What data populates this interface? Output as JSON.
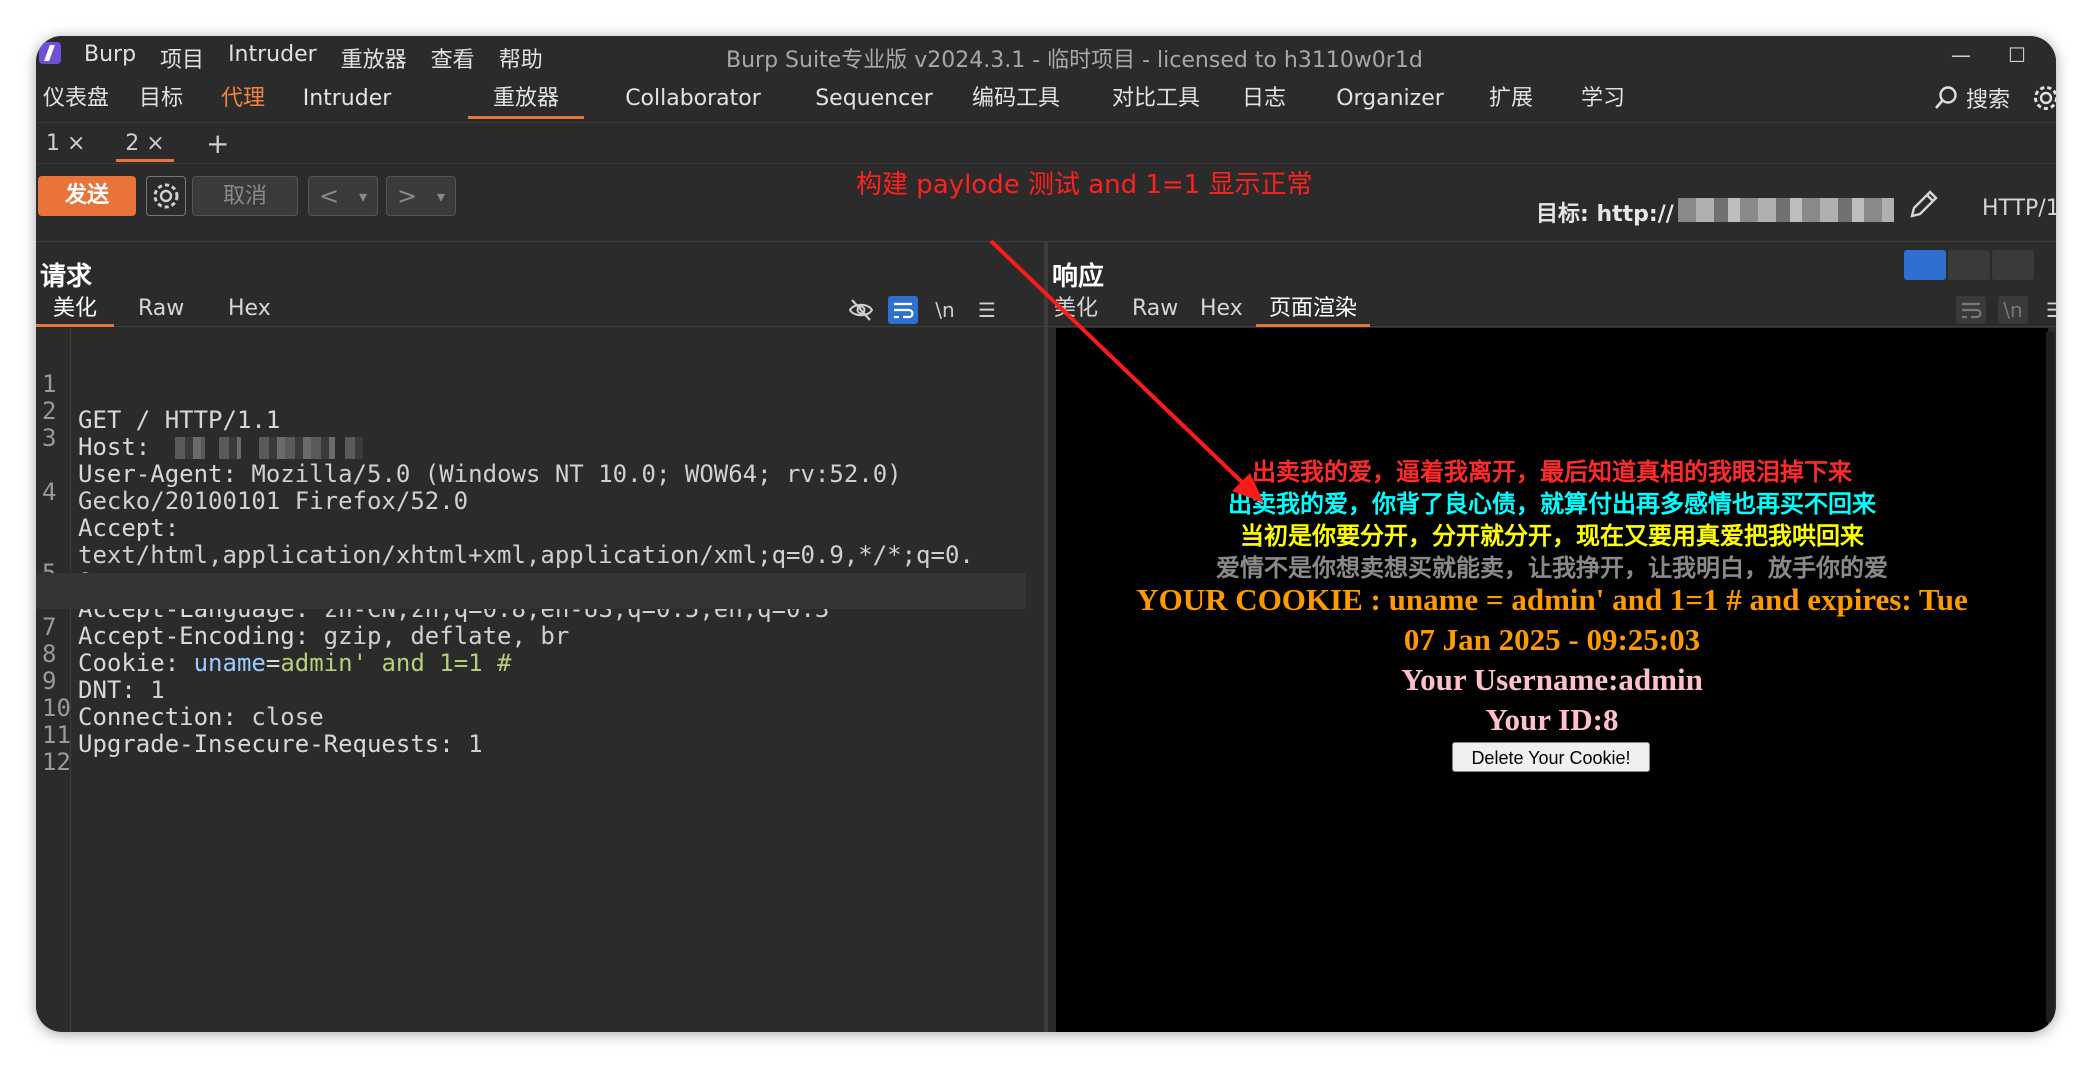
{
  "titlebar": {
    "menu": [
      "Burp",
      "项目",
      "Intruder",
      "重放器",
      "查看",
      "帮助"
    ],
    "title": "Burp Suite专业版  v2024.3.1 - 临时项目 - licensed to h3110w0r1d"
  },
  "main_tabs": [
    "仪表盘",
    "目标",
    "代理",
    "Intruder",
    "重放器",
    "Collaborator",
    "Sequencer",
    "编码工具",
    "对比工具",
    "日志",
    "Organizer",
    "扩展",
    "学习"
  ],
  "main_tab_active": "重放器",
  "search_label": "搜索",
  "repeater_tabs": [
    {
      "label": "1 ×"
    },
    {
      "label": "2 ×",
      "active": true
    }
  ],
  "add_tab_label": "+",
  "toolbar": {
    "send_label": "发送",
    "cancel_label": "取消",
    "prev_label": "<",
    "next_label": ">",
    "dropdown_label": "▾",
    "target_label": "目标: http://",
    "protocol_label": "HTTP/1"
  },
  "annotation": "构建 paylode 测试 and 1=1 显示正常",
  "request": {
    "title": "请求",
    "tabs": [
      "美化",
      "Raw",
      "Hex"
    ],
    "newline_label": "\\n",
    "lines": [
      {
        "n": "1",
        "key": "GET / HTTP/1.1",
        "sep": "",
        "value": ""
      },
      {
        "n": "2",
        "key": "Host",
        "sep": ": ",
        "value": ""
      },
      {
        "n": "3",
        "key": "User-Agent",
        "sep": ": ",
        "value": "Mozilla/5.0 (Windows NT 10.0; WOW64; rv:52.0)"
      },
      {
        "n": "",
        "key": "",
        "sep": "",
        "value": "Gecko/20100101 Firefox/52.0"
      },
      {
        "n": "4",
        "key": "Accept",
        "sep": ":",
        "value": ""
      },
      {
        "n": "",
        "key": "",
        "sep": "",
        "value": "text/html,application/xhtml+xml,application/xml;q=0.9,*/*;q=0."
      },
      {
        "n": "",
        "key": "",
        "sep": "",
        "value": "8"
      },
      {
        "n": "5",
        "key": "Accept-Language",
        "sep": ": ",
        "value": "zh-CN,zh;q=0.8,en-US;q=0.5,en;q=0.3"
      },
      {
        "n": "6",
        "key": "Accept-Encoding",
        "sep": ": ",
        "value": "gzip, deflate, br"
      },
      {
        "n": "7",
        "key": "Cookie",
        "sep": ": ",
        "value": ""
      },
      {
        "n": "8",
        "key": "DNT",
        "sep": ": ",
        "value": "1"
      },
      {
        "n": "9",
        "key": "Connection",
        "sep": ": ",
        "value": "close"
      },
      {
        "n": "10",
        "key": "Upgrade-Insecure-Requests",
        "sep": ": ",
        "value": "1"
      },
      {
        "n": "11",
        "key": "",
        "sep": "",
        "value": ""
      },
      {
        "n": "12",
        "key": "",
        "sep": "",
        "value": ""
      }
    ],
    "cookie_name": "uname",
    "cookie_eq": "=",
    "cookie_value": "admin",
    "cookie_payload": "' and 1=1 #"
  },
  "response": {
    "title": "响应",
    "tabs": [
      "美化",
      "Raw",
      "Hex",
      "页面渲染"
    ],
    "newline_label": "\\n",
    "rendered": {
      "lines": [
        {
          "text": "出卖我的爱，逼着我离开，最后知道真相的我眼泪掉下来",
          "color": "#ff2a2a"
        },
        {
          "text": "出卖我的爱，你背了良心债，就算付出再多感情也再买不回来",
          "color": "#00ffff"
        },
        {
          "text": "当初是你要分开，分开就分开，现在又要用真爱把我哄回来",
          "color": "#ffff00"
        },
        {
          "text": "爱情不是你想卖想买就能卖，让我挣开，让我明白，放手你的爱",
          "color": "#8a8a8a"
        },
        {
          "text": "YOUR COOKIE : uname = admin' and 1=1 # and expires: Tue",
          "color": "#ff9900"
        },
        {
          "text": "07 Jan 2025 - 09:25:03",
          "color": "#ff9900"
        },
        {
          "text": "Your Username:admin",
          "color": "#ffc0cb"
        },
        {
          "text": "Your ID:8",
          "color": "#ffc0cb"
        }
      ],
      "button_label": "Delete Your Cookie!"
    }
  },
  "colors": {
    "accent": "#e8743b",
    "annotation": "#ff2020",
    "selection_blue": "#2f6fd0"
  }
}
